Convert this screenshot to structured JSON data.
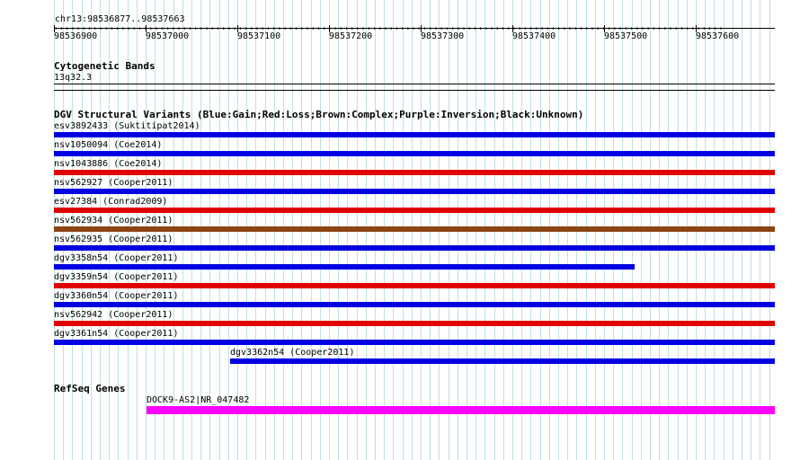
{
  "coordinates": {
    "label": "chr13:98536877..98537663"
  },
  "ruler": {
    "ticks": [
      "98536900",
      "98537000",
      "98537100",
      "98537200",
      "98537300",
      "98537400",
      "98537500",
      "98537600"
    ]
  },
  "cytoband": {
    "title": "Cytogenetic Bands",
    "band": "13q32.3"
  },
  "dgv": {
    "title": "DGV Structural Variants (Blue:Gain;Red:Loss;Brown:Complex;Purple:Inversion;Black:Unknown)",
    "colors": {
      "gain": "#0000e0",
      "loss": "#e00000",
      "complex": "#8b4513",
      "inversion": "#800080",
      "unknown": "#000000"
    },
    "variants": [
      {
        "label": "esv3892433 (Suktitipat2014)",
        "type": "gain"
      },
      {
        "label": "nsv1050094 (Coe2014)",
        "type": "gain"
      },
      {
        "label": "nsv1043886 (Coe2014)",
        "type": "loss"
      },
      {
        "label": "nsv562927 (Cooper2011)",
        "type": "gain"
      },
      {
        "label": "esv27384 (Conrad2009)",
        "type": "loss"
      },
      {
        "label": "nsv562934 (Cooper2011)",
        "type": "complex"
      },
      {
        "label": "nsv562935 (Cooper2011)",
        "type": "gain"
      },
      {
        "label": "dgv3358n54 (Cooper2011)",
        "type": "gain"
      },
      {
        "label": "dgv3359n54 (Cooper2011)",
        "type": "loss"
      },
      {
        "label": "dgv3360n54 (Cooper2011)",
        "type": "gain"
      },
      {
        "label": "nsv562942 (Cooper2011)",
        "type": "loss"
      },
      {
        "label": "dgv3361n54 (Cooper2011)",
        "type": "gain"
      },
      {
        "label": "dgv3362n54 (Cooper2011)",
        "type": "gain"
      }
    ]
  },
  "refseq": {
    "title": "RefSeq Genes",
    "gene": {
      "label": "DOCK9-AS2|NR_047482",
      "color": "#ff00ff"
    }
  }
}
